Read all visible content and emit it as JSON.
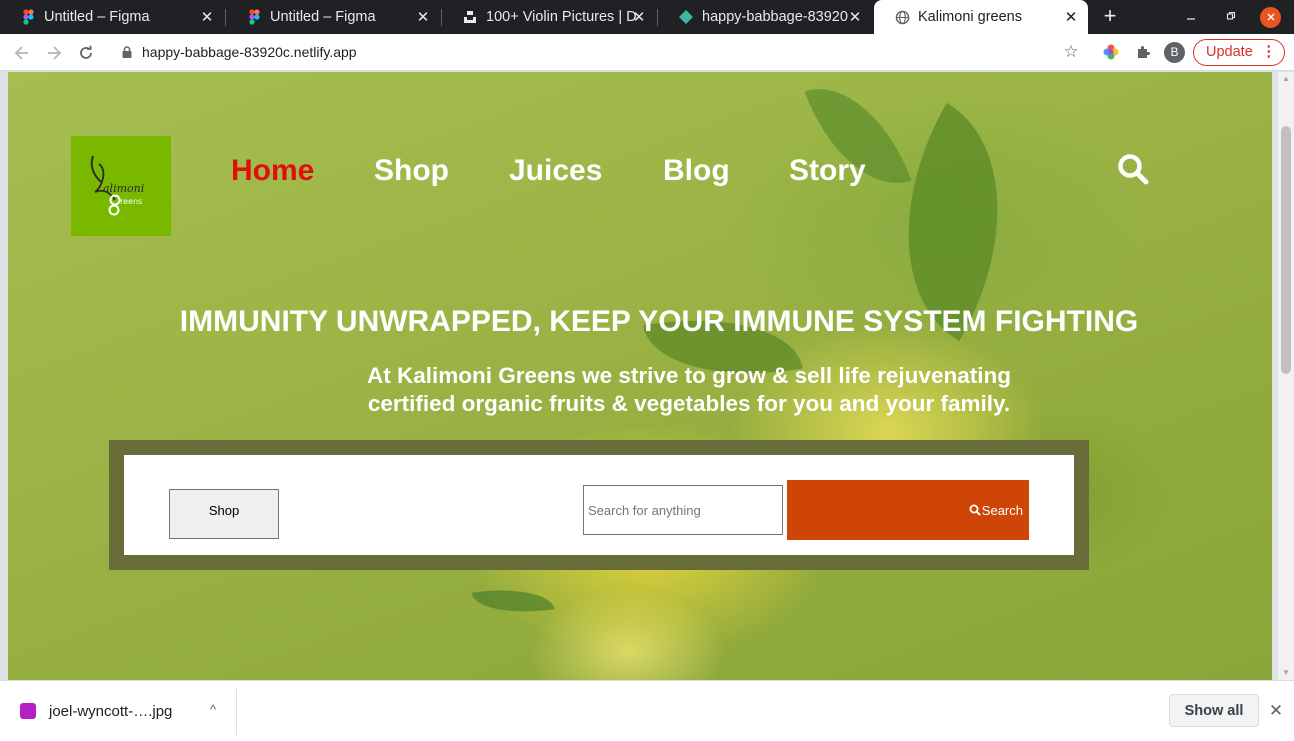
{
  "browser": {
    "tabs": [
      {
        "title": "Untitled – Figma",
        "icon": "figma-icon",
        "active": false
      },
      {
        "title": "Untitled – Figma",
        "icon": "figma-icon",
        "active": false
      },
      {
        "title": "100+ Violin Pictures | D",
        "icon": "unsplash-icon",
        "active": false
      },
      {
        "title": "happy-babbage-83920",
        "icon": "netlify-icon",
        "active": false
      },
      {
        "title": "Kalimoni greens",
        "icon": "globe-icon",
        "active": true
      }
    ],
    "close_glyph": "✕",
    "new_tab_glyph": "+",
    "url": "happy-babbage-83920c.netlify.app",
    "profile_initial": "B",
    "update_label": "Update",
    "update_menu_glyph": "⋮"
  },
  "site": {
    "logo": {
      "line1": "alimoni",
      "line2": "reens",
      "bg_color": "#7ab800"
    },
    "nav": [
      "Home",
      "Shop",
      "Juices",
      "Blog",
      "Story"
    ],
    "active_nav_color": "#e20d0d",
    "headline": "IMMUNITY UNWRAPPED, KEEP YOUR IMMUNE SYSTEM FIGHTING",
    "subtitle_line1": "At Kalimoni Greens we strive to grow & sell life rejuvenating",
    "subtitle_line2": "certified organic fruits & vegetables for you and your family.",
    "shop_button": "Shop",
    "search_placeholder": "Search for anything",
    "search_button": "Search",
    "search_button_color": "#cf4507",
    "panel_color": "#676c38"
  },
  "downloads": {
    "file_name": "joel-wyncott-….jpg",
    "chevron_glyph": "^",
    "show_all": "Show all",
    "close_glyph": "✕"
  }
}
